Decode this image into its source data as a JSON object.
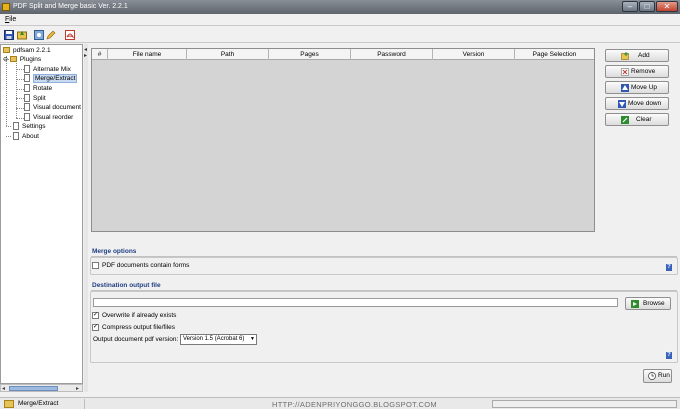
{
  "window": {
    "title": "PDF Split and Merge basic Ver. 2.2.1"
  },
  "menubar": {
    "file": "File"
  },
  "toolbar": {
    "icons": [
      "save-icon",
      "open-icon",
      "settings-icon",
      "edit-icon",
      "pdf-icon"
    ]
  },
  "tree": {
    "root": "pdfsam 2.2.1",
    "plugins": "Plugins",
    "plugin_items": [
      "Alternate Mix",
      "Merge/Extract",
      "Rotate",
      "Split",
      "Visual document",
      "Visual reorder"
    ],
    "selected": "Merge/Extract",
    "settings": "Settings",
    "about": "About"
  },
  "table": {
    "columns": [
      "#",
      "File name",
      "Path",
      "Pages",
      "Password",
      "Version",
      "Page Selection"
    ]
  },
  "buttons": {
    "add": "Add",
    "remove": "Remove",
    "move_up": "Move Up",
    "move_down": "Move down",
    "clear": "Clear",
    "browse": "Browse",
    "run": "Run"
  },
  "merge_options": {
    "title": "Merge options",
    "forms_label": "PDF documents contain forms",
    "forms_checked": false
  },
  "destination": {
    "title": "Destination output file",
    "path_value": "",
    "overwrite_label": "Overwrite if already exists",
    "overwrite_checked": true,
    "compress_label": "Compress output file/files",
    "compress_checked": true,
    "version_label": "Output document pdf version:",
    "version_value": "Version 1.5 (Acrobat 6)"
  },
  "help_glyph": "?",
  "statusbar": {
    "plugin": "Merge/Extract",
    "watermark": "HTTP://ADENPRIYONGGO.BLOGSPOT.COM"
  },
  "colors": {
    "section_title": "#1f3e82",
    "selection": "#c9dbf2",
    "help_icon": "#3a62b8"
  }
}
